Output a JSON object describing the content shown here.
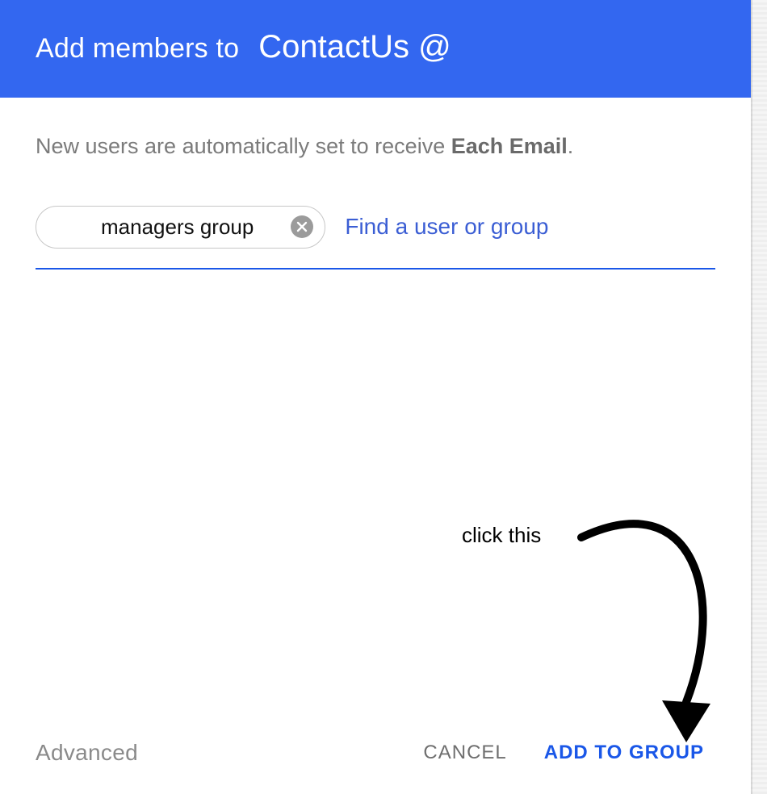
{
  "header": {
    "title_prefix": "Add members to",
    "group_name": "ContactUs @"
  },
  "info": {
    "text_before": "New users are automatically set to receive ",
    "strong": "Each Email",
    "text_after": "."
  },
  "chip": {
    "label": "managers group"
  },
  "search": {
    "placeholder": "Find a user or group",
    "value": ""
  },
  "annotation": {
    "text": "click this"
  },
  "footer": {
    "advanced": "Advanced",
    "cancel": "CANCEL",
    "add": "ADD TO GROUP"
  }
}
